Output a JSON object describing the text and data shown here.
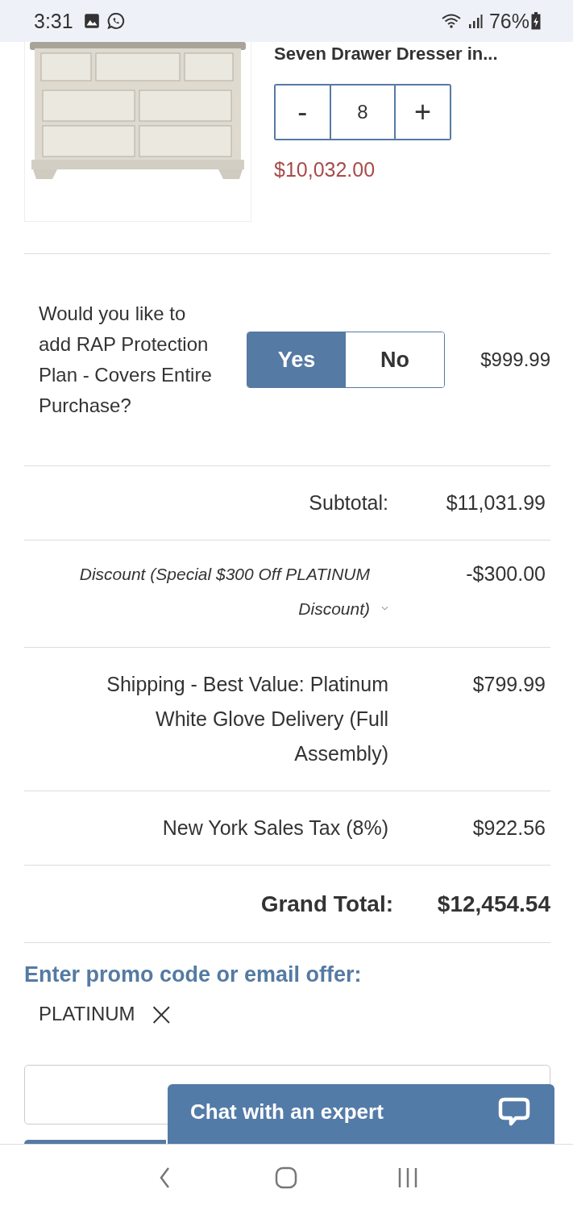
{
  "status_bar": {
    "time": "3:31",
    "battery": "76%"
  },
  "product": {
    "kind": "picture",
    "title": "Seven Drawer Dresser in...",
    "quantity": "8",
    "minus": "-",
    "plus": "+",
    "price": "$10,032.00"
  },
  "protection": {
    "question": "Would you like to add RAP Protection Plan - Covers Entire Purchase?",
    "options": [
      {
        "label": "Yes",
        "selected": true
      },
      {
        "label": "No",
        "selected": false
      }
    ],
    "price": "$999.99"
  },
  "summary": [
    {
      "kind": "normal",
      "label": "Subtotal:",
      "value": "$11,031.99"
    },
    {
      "kind": "discount",
      "label": "Discount (Special $300 Off PLATINUM Discount)",
      "value": "-$300.00"
    },
    {
      "kind": "normal",
      "label": "Shipping - Best Value: Platinum White Glove Delivery (Full Assembly)",
      "value": "$799.99"
    },
    {
      "kind": "normal",
      "label": "New York Sales Tax (8%)",
      "value": "$922.56"
    },
    {
      "kind": "total",
      "label": "Grand Total:",
      "value": "$12,454.54"
    }
  ],
  "promo": {
    "heading": "Enter promo code or email offer:",
    "applied_code": "PLATINUM",
    "remove": "×"
  },
  "chat": {
    "label": "Chat with an expert"
  }
}
